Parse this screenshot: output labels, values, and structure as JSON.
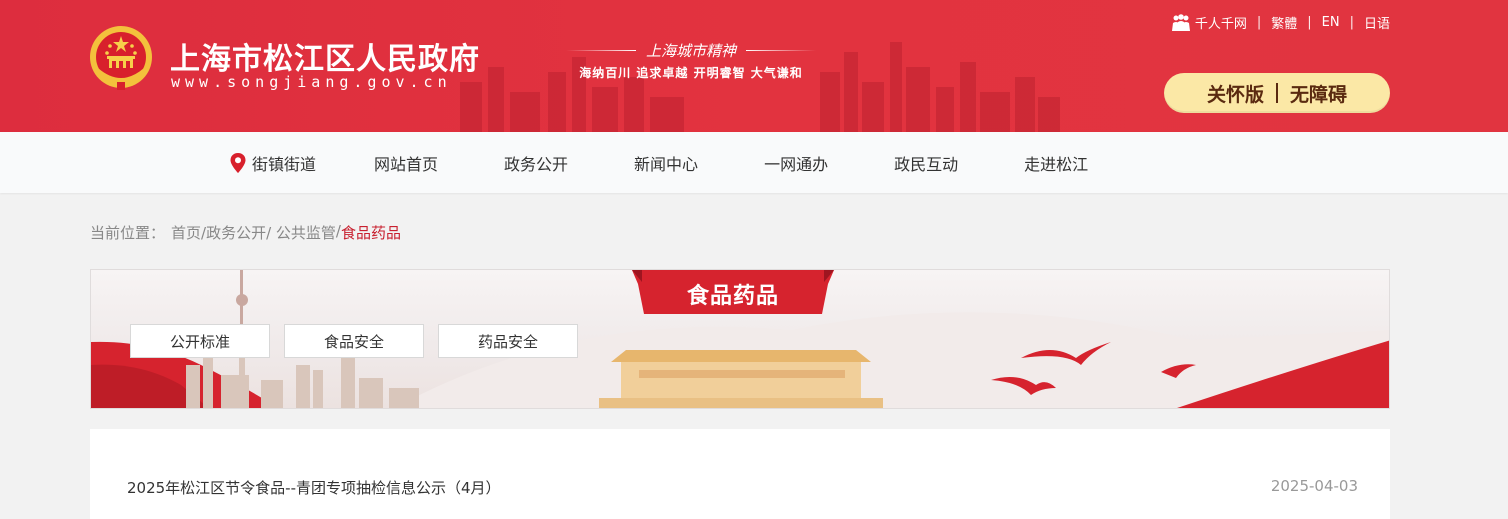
{
  "header": {
    "site_title": "上海市松江区人民政府",
    "site_url": "www.songjiang.gov.cn",
    "slogan_title": "上海城市精神",
    "slogan_sub": "海纳百川  追求卓越  开明睿智  大气谦和",
    "toplinks": [
      {
        "label": "千人千网",
        "icon": "people-icon"
      },
      {
        "label": "繁體"
      },
      {
        "label": "EN"
      },
      {
        "label": "日语"
      }
    ],
    "care_mode": "关怀版",
    "accessibility": "无障碍",
    "brand_color": "#e2333f"
  },
  "nav": {
    "items": [
      {
        "label": "街镇街道",
        "icon": "location-pin-icon"
      },
      {
        "label": "网站首页"
      },
      {
        "label": "政务公开"
      },
      {
        "label": "新闻中心"
      },
      {
        "label": "一网通办"
      },
      {
        "label": "政民互动"
      },
      {
        "label": "走进松江"
      }
    ]
  },
  "breadcrumb": {
    "prefix": "当前位置：",
    "items": [
      "首页",
      "/政务公开",
      "/ 公共监管",
      "/"
    ],
    "current": "食品药品"
  },
  "banner": {
    "category_title": "食品药品",
    "tabs": [
      "公开标准",
      "食品安全",
      "药品安全"
    ]
  },
  "list": {
    "items": [
      {
        "title": "2025年松江区节令食品--青团专项抽检信息公示（4月）",
        "date": "2025-04-03"
      }
    ]
  }
}
